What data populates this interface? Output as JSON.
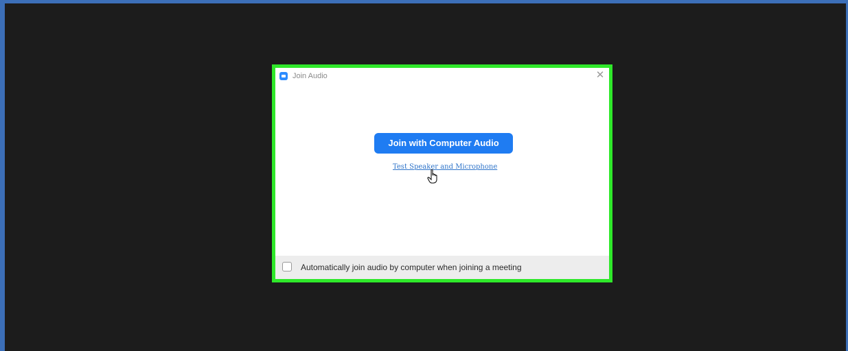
{
  "dialog": {
    "title": "Join Audio",
    "close_icon": "close-icon",
    "primary_button_label": "Join with Computer Audio",
    "test_link_label": "Test Speaker and Microphone",
    "checkbox_label": "Automatically join audio by computer when joining a meeting",
    "checkbox_checked": false
  },
  "icons": {
    "app": "zoom-app-icon",
    "cursor": "hand-pointer-cursor-icon"
  },
  "colors": {
    "primary": "#1f7cf2",
    "highlight": "#2fe82a",
    "background": "#1c1c1c",
    "link": "#2d73c9"
  }
}
